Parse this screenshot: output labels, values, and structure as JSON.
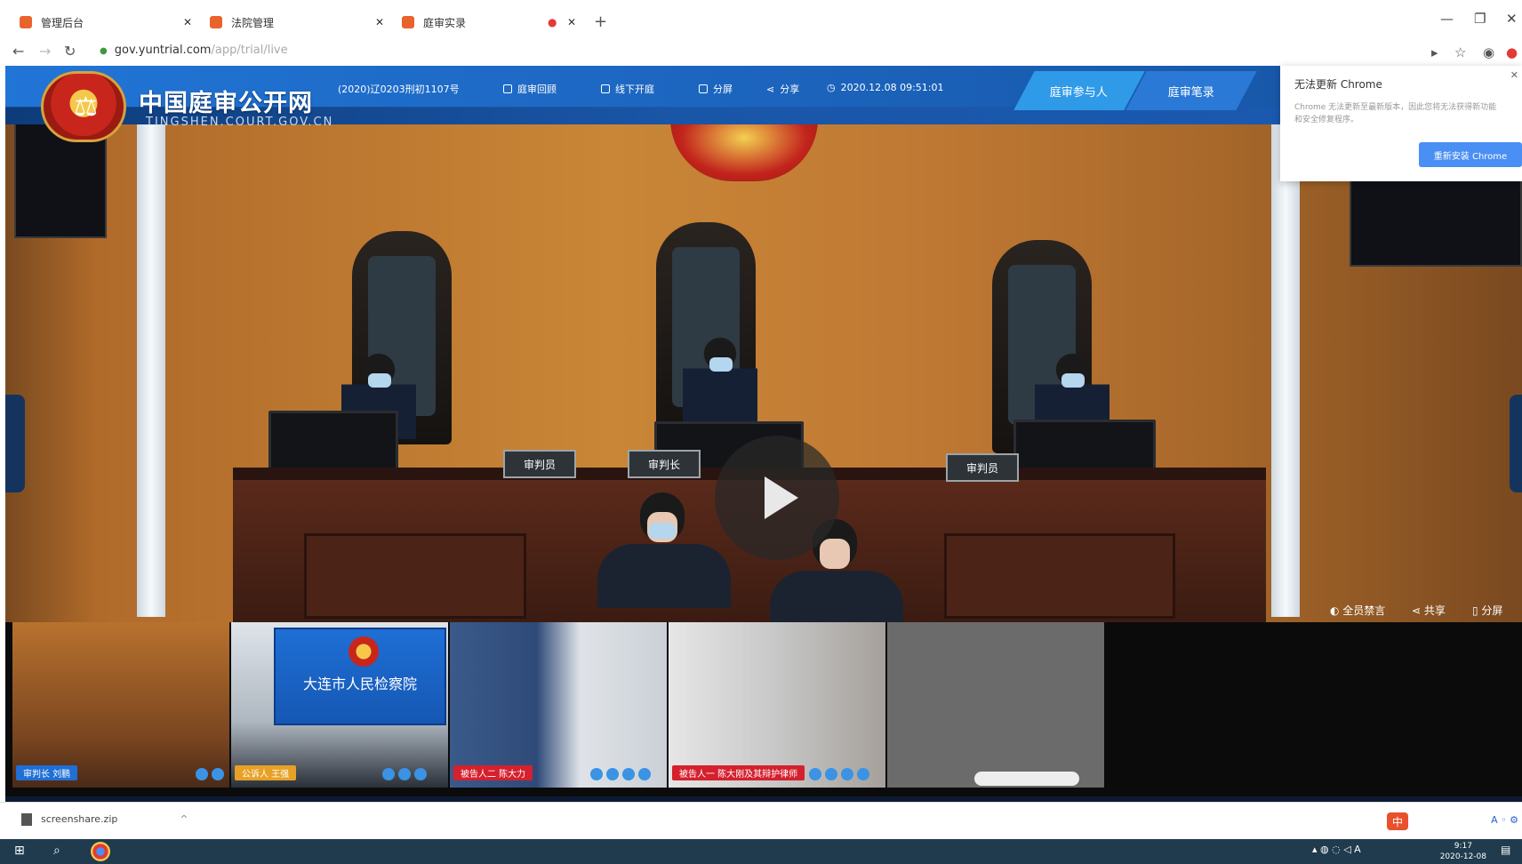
{
  "browser": {
    "tabs": [
      {
        "label": "管理后台"
      },
      {
        "label": "法院管理"
      },
      {
        "label": "庭审实录"
      }
    ],
    "new_tab": "+",
    "url_domain": "gov.yuntrial.com",
    "url_path": "/app/trial/live",
    "window_controls": {
      "minimize": "—",
      "restore": "❐",
      "close": "✕"
    }
  },
  "site": {
    "logo_title": "中国庭审公开网",
    "logo_subtitle": "TINGSHEN.COURT.GOV.CN",
    "case_number": "(2020)辽0203刑初1107号",
    "nav": [
      {
        "label": "庭审回顾"
      },
      {
        "label": "线下开庭"
      },
      {
        "label": "分屏"
      },
      {
        "label": "分享"
      },
      {
        "label": "2020.12.08 09:51:01"
      }
    ],
    "btn_participants": "庭审参与人",
    "btn_record": "庭审笔录"
  },
  "courtroom": {
    "nameplates": [
      "审判员",
      "审判长",
      "审判员"
    ]
  },
  "popup": {
    "title": "无法更新 Chrome",
    "text": "Chrome 无法更新至最新版本，因此您将无法获得新功能和安全修复程序。",
    "button": "重新安装 Chrome",
    "close": "✕"
  },
  "video_controls": {
    "mute_all": "全员禁言",
    "share": "共享",
    "split": "分屏"
  },
  "thumbnails": [
    {
      "label": "审判长 刘鹏"
    },
    {
      "label": "公诉人 王强",
      "banner": "大连市人民检察院"
    },
    {
      "label": "被告人二 陈大力"
    },
    {
      "label": "被告人一 陈大刚及其辩护律师"
    }
  ],
  "download": {
    "file": "screenshare.zip"
  },
  "taskbar": {
    "time": "9:17",
    "date": "2020-12-08"
  },
  "ime": {
    "label": "中"
  }
}
